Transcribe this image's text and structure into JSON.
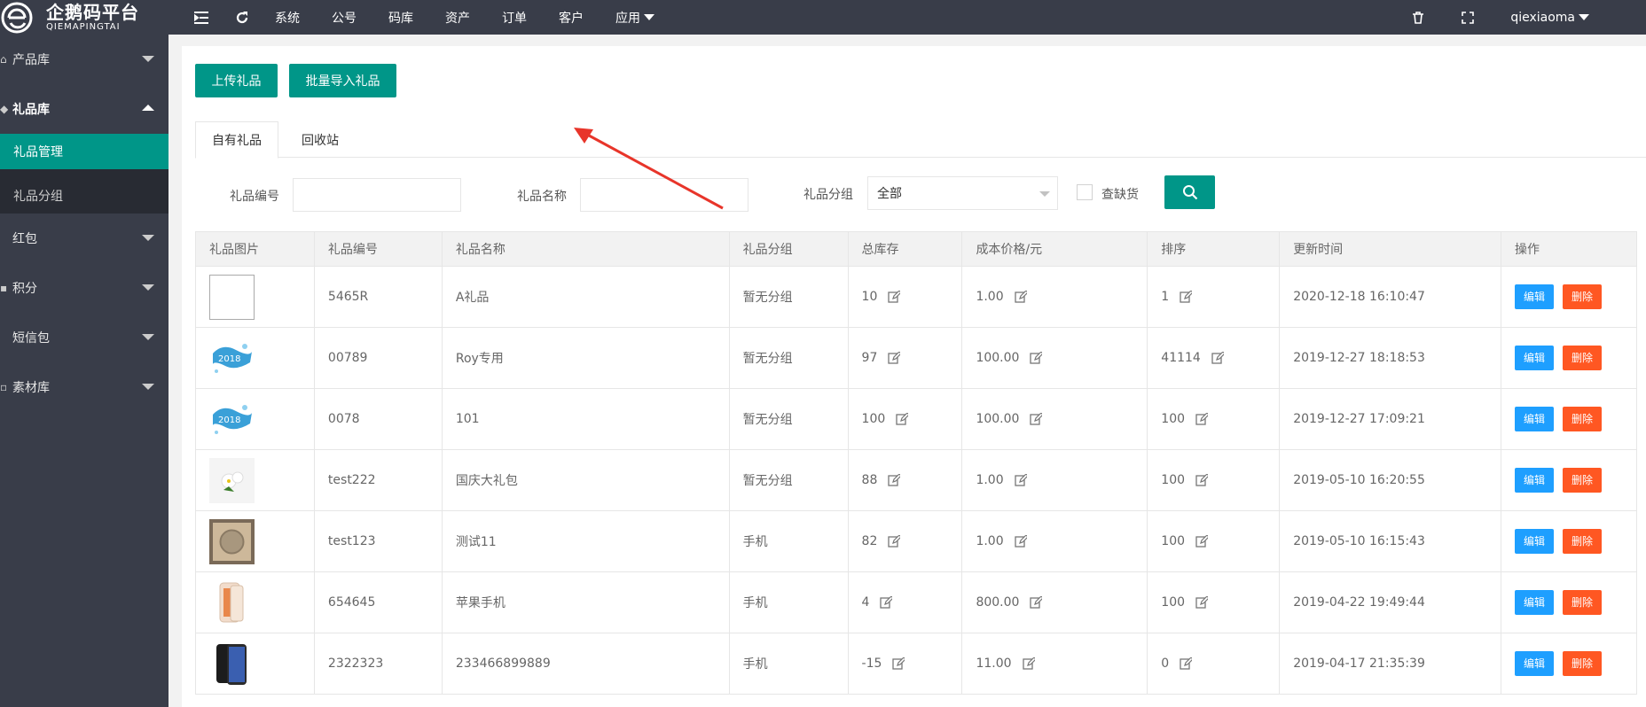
{
  "brand": {
    "name_cn": "企鹅码平台",
    "name_en": "QIEMAPINGTAI"
  },
  "topnav": {
    "items": [
      {
        "label": "系统"
      },
      {
        "label": "公号"
      },
      {
        "label": "码库"
      },
      {
        "label": "资产"
      },
      {
        "label": "订单"
      },
      {
        "label": "客户"
      },
      {
        "label": "应用"
      }
    ],
    "user": "qiexiaoma",
    "icons": [
      "menu-collapse-icon",
      "refresh-icon",
      "trash-icon",
      "fullscreen-icon"
    ]
  },
  "sidebar": {
    "items": [
      {
        "label": "产品库",
        "expanded": false
      },
      {
        "label": "礼品库",
        "expanded": true,
        "children": [
          {
            "label": "礼品管理",
            "active": true
          },
          {
            "label": "礼品分组",
            "active": false
          }
        ]
      },
      {
        "label": "红包",
        "expanded": false
      },
      {
        "label": "积分",
        "expanded": false
      },
      {
        "label": "短信包",
        "expanded": false
      },
      {
        "label": "素材库",
        "expanded": false
      }
    ]
  },
  "toolbar": {
    "upload_label": "上传礼品",
    "batch_import_label": "批量导入礼品"
  },
  "tabs": [
    {
      "label": "自有礼品",
      "active": true
    },
    {
      "label": "回收站",
      "active": false
    }
  ],
  "filters": {
    "code_label": "礼品编号",
    "code_value": "",
    "name_label": "礼品名称",
    "name_value": "",
    "group_label": "礼品分组",
    "group_selected": "全部",
    "out_of_stock_label": "查缺货",
    "out_of_stock_checked": false
  },
  "table": {
    "columns": [
      "礼品图片",
      "礼品编号",
      "礼品名称",
      "礼品分组",
      "总库存",
      "成本价格/元",
      "排序",
      "更新时间",
      "操作"
    ],
    "rows": [
      {
        "image": "blank",
        "code": "5465R",
        "name": "A礼品",
        "group": "暂无分组",
        "stock": "10",
        "cost": "1.00",
        "sort": "1",
        "updated": "2020-12-18 16:10:47"
      },
      {
        "image": "snow",
        "code": "00789",
        "name": "Roy专用",
        "group": "暂无分组",
        "stock": "97",
        "cost": "100.00",
        "sort": "41114",
        "updated": "2019-12-27 18:18:53"
      },
      {
        "image": "snow",
        "code": "0078",
        "name": "101",
        "group": "暂无分组",
        "stock": "100",
        "cost": "100.00",
        "sort": "100",
        "updated": "2019-12-27 17:09:21"
      },
      {
        "image": "flower",
        "code": "test222",
        "name": "国庆大礼包",
        "group": "暂无分组",
        "stock": "88",
        "cost": "1.00",
        "sort": "100",
        "updated": "2019-05-10 16:20:55"
      },
      {
        "image": "coin",
        "code": "test123",
        "name": "测试11",
        "group": "手机",
        "stock": "82",
        "cost": "1.00",
        "sort": "100",
        "updated": "2019-05-10 16:15:43"
      },
      {
        "image": "phone-gold",
        "code": "654645",
        "name": "苹果手机",
        "group": "手机",
        "stock": "4",
        "cost": "800.00",
        "sort": "100",
        "updated": "2019-04-22 19:49:44"
      },
      {
        "image": "phone-black",
        "code": "2322323",
        "name": "233466899889",
        "group": "手机",
        "stock": "-15",
        "cost": "11.00",
        "sort": "0",
        "updated": "2019-04-17 21:35:39"
      }
    ],
    "edit_label": "编辑",
    "delete_label": "删除"
  },
  "colors": {
    "primary": "#009688",
    "sidebar": "#393d49",
    "edit": "#1e9fff",
    "delete": "#ff5722",
    "annotation": "#e8352a"
  }
}
